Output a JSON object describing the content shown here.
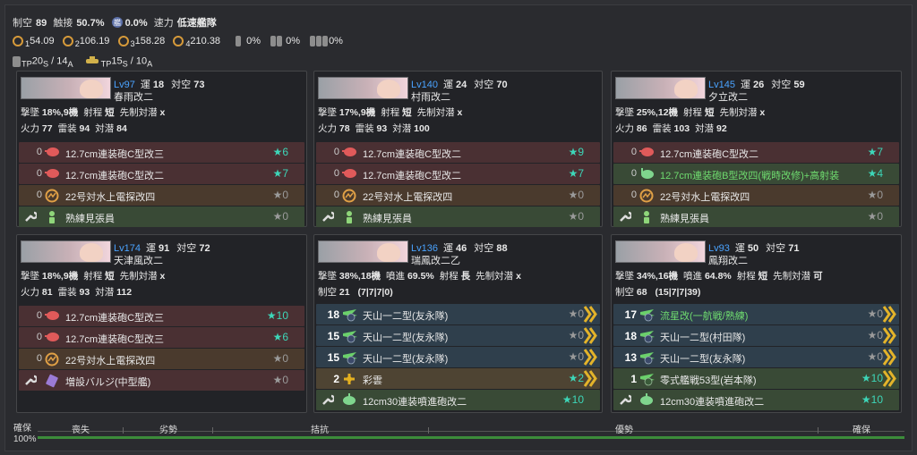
{
  "header": {
    "line1": {
      "seiku_label": "制空",
      "seiku": "89",
      "sessen_label": "触接",
      "sessen": "50.7%",
      "sessen2": "0.0%",
      "speed_label": "速力",
      "speed": "低速艦隊"
    },
    "line2": {
      "los1": "1",
      "los1v": "54.09",
      "los2": "2",
      "los2v": "106.19",
      "los3": "3",
      "los3v": "158.28",
      "los4": "4",
      "los4v": "210.38",
      "drum1": "0%",
      "drum2": "0%",
      "drum3": "0%"
    },
    "line3": {
      "tp_label": "TP",
      "tp_s": "20",
      "tp_s_sub": "S",
      "tp_a": "14",
      "tp_a_sub": "A",
      "tp2_label": "TP",
      "tp2_s": "15",
      "tp2_s_sub": "S",
      "tp2_a": "10",
      "tp2_a_sub": "A"
    }
  },
  "ships": [
    {
      "lv": "Lv97",
      "luck_label": "運",
      "luck": "18",
      "aa_label": "対空",
      "aa": "73",
      "name": "春雨改二",
      "line1": [
        {
          "l": "撃墜",
          "v": "18%,9機"
        },
        {
          "l": "射程",
          "v": "短"
        },
        {
          "l": "先制対潜",
          "v": "x"
        }
      ],
      "line2": [
        {
          "l": "火力",
          "v": "77"
        },
        {
          "l": "雷装",
          "v": "94"
        },
        {
          "l": "対潜",
          "v": "84"
        }
      ],
      "slots": [
        {
          "type": "red",
          "icon": "gun-icon",
          "count": "0",
          "name": "12.7cm連装砲C型改三",
          "star": "★6",
          "sc": "teal"
        },
        {
          "type": "red",
          "icon": "gun-icon",
          "count": "0",
          "name": "12.7cm連装砲C型改二",
          "star": "★7",
          "sc": "teal"
        },
        {
          "type": "brn",
          "icon": "radar-icon",
          "count": "0",
          "name": "22号対水上電探改四",
          "star": "★0",
          "sc": "grey"
        },
        {
          "type": "grn",
          "icon": "lookout-icon",
          "count": "",
          "name": "熟練見張員",
          "star": "★0",
          "sc": "grey",
          "ex": true
        }
      ]
    },
    {
      "lv": "Lv140",
      "luck_label": "運",
      "luck": "24",
      "aa_label": "対空",
      "aa": "70",
      "name": "村雨改二",
      "line1": [
        {
          "l": "撃墜",
          "v": "17%,9機"
        },
        {
          "l": "射程",
          "v": "短"
        },
        {
          "l": "先制対潜",
          "v": "x"
        }
      ],
      "line2": [
        {
          "l": "火力",
          "v": "78"
        },
        {
          "l": "雷装",
          "v": "93"
        },
        {
          "l": "対潜",
          "v": "100"
        }
      ],
      "slots": [
        {
          "type": "red",
          "icon": "gun-icon",
          "count": "0",
          "name": "12.7cm連装砲C型改二",
          "star": "★9",
          "sc": "teal"
        },
        {
          "type": "red",
          "icon": "gun-icon",
          "count": "0",
          "name": "12.7cm連装砲C型改二",
          "star": "★7",
          "sc": "teal"
        },
        {
          "type": "brn",
          "icon": "radar-icon",
          "count": "0",
          "name": "22号対水上電探改四",
          "star": "★0",
          "sc": "grey"
        },
        {
          "type": "grn",
          "icon": "lookout-icon",
          "count": "",
          "name": "熟練見張員",
          "star": "★0",
          "sc": "grey",
          "ex": true
        }
      ]
    },
    {
      "lv": "Lv145",
      "luck_label": "運",
      "luck": "26",
      "aa_label": "対空",
      "aa": "59",
      "name": "夕立改二",
      "line1": [
        {
          "l": "撃墜",
          "v": "25%,12機"
        },
        {
          "l": "射程",
          "v": "短"
        },
        {
          "l": "先制対潜",
          "v": "x"
        }
      ],
      "line2": [
        {
          "l": "火力",
          "v": "86"
        },
        {
          "l": "雷装",
          "v": "103"
        },
        {
          "l": "対潜",
          "v": "92"
        }
      ],
      "slots": [
        {
          "type": "red",
          "icon": "gun-icon",
          "count": "0",
          "name": "12.7cm連装砲C型改二",
          "star": "★7",
          "sc": "teal"
        },
        {
          "type": "grn",
          "icon": "aa-gun-icon",
          "count": "0",
          "name": "12.7cm連装砲B型改四(戦時改修)+高射装",
          "star": "★4",
          "sc": "teal",
          "green": true
        },
        {
          "type": "brn",
          "icon": "radar-icon",
          "count": "0",
          "name": "22号対水上電探改四",
          "star": "★0",
          "sc": "grey"
        },
        {
          "type": "grn",
          "icon": "lookout-icon",
          "count": "",
          "name": "熟練見張員",
          "star": "★0",
          "sc": "grey",
          "ex": true
        }
      ]
    },
    {
      "lv": "Lv174",
      "luck_label": "運",
      "luck": "91",
      "aa_label": "対空",
      "aa": "72",
      "name": "天津風改二",
      "line1": [
        {
          "l": "撃墜",
          "v": "18%,9機"
        },
        {
          "l": "射程",
          "v": "短"
        },
        {
          "l": "先制対潜",
          "v": "x"
        }
      ],
      "line2": [
        {
          "l": "火力",
          "v": "81"
        },
        {
          "l": "雷装",
          "v": "93"
        },
        {
          "l": "対潜",
          "v": "112"
        }
      ],
      "slots": [
        {
          "type": "red",
          "icon": "gun-icon",
          "count": "0",
          "name": "12.7cm連装砲C型改三",
          "star": "★10",
          "sc": "teal"
        },
        {
          "type": "red",
          "icon": "gun-icon",
          "count": "0",
          "name": "12.7cm連装砲C型改三",
          "star": "★6",
          "sc": "teal"
        },
        {
          "type": "brn",
          "icon": "radar-icon",
          "count": "0",
          "name": "22号対水上電探改四",
          "star": "★0",
          "sc": "grey"
        },
        {
          "type": "red",
          "icon": "bulge-icon",
          "count": "",
          "name": "増設バルジ(中型艦)",
          "star": "★0",
          "sc": "grey",
          "ex": true
        }
      ]
    },
    {
      "lv": "Lv136",
      "luck_label": "運",
      "luck": "46",
      "aa_label": "対空",
      "aa": "88",
      "name": "瑞鳳改二乙",
      "line1": [
        {
          "l": "撃墜",
          "v": "38%,18機"
        },
        {
          "l": "噴進",
          "v": "69.5%"
        },
        {
          "l": "射程",
          "v": "長"
        },
        {
          "l": "先制対潜",
          "v": "x"
        }
      ],
      "line2": [
        {
          "l": "制空",
          "v": "21"
        },
        {
          "l": "",
          "v": "(7|7|7|0)"
        }
      ],
      "slots": [
        {
          "type": "blu",
          "icon": "torpedo-bomber-icon",
          "count": "18",
          "name": "天山一二型(友永隊)",
          "star": "★0",
          "sc": "grey",
          "chev": true
        },
        {
          "type": "blu",
          "icon": "torpedo-bomber-icon",
          "count": "15",
          "name": "天山一二型(友永隊)",
          "star": "★0",
          "sc": "grey",
          "chev": true
        },
        {
          "type": "blu",
          "icon": "torpedo-bomber-icon",
          "count": "15",
          "name": "天山一二型(友永隊)",
          "star": "★0",
          "sc": "grey",
          "chev": true
        },
        {
          "type": "yel",
          "icon": "recon-plane-icon",
          "count": "2",
          "name": "彩雲",
          "star": "★2",
          "sc": "teal",
          "chev": true
        },
        {
          "type": "grn",
          "icon": "rocket-aa-icon",
          "count": "",
          "name": "12cm30連装噴進砲改二",
          "star": "★10",
          "sc": "teal",
          "ex": true
        }
      ]
    },
    {
      "lv": "Lv93",
      "luck_label": "運",
      "luck": "50",
      "aa_label": "対空",
      "aa": "71",
      "name": "鳳翔改二",
      "line1": [
        {
          "l": "撃墜",
          "v": "34%,16機"
        },
        {
          "l": "噴進",
          "v": "64.8%"
        },
        {
          "l": "射程",
          "v": "短"
        },
        {
          "l": "先制対潜",
          "v": "可"
        }
      ],
      "line2": [
        {
          "l": "制空",
          "v": "68"
        },
        {
          "l": "",
          "v": "(15|7|7|39)"
        }
      ],
      "slots": [
        {
          "type": "blu",
          "icon": "torpedo-bomber-icon",
          "count": "17",
          "name": "流星改(一航戦/熟練)",
          "star": "★0",
          "sc": "grey",
          "chev": true,
          "green": true
        },
        {
          "type": "blu",
          "icon": "torpedo-bomber-icon",
          "count": "18",
          "name": "天山一二型(村田隊)",
          "star": "★0",
          "sc": "grey",
          "chev": true
        },
        {
          "type": "blu",
          "icon": "torpedo-bomber-icon",
          "count": "13",
          "name": "天山一二型(友永隊)",
          "star": "★0",
          "sc": "grey",
          "chev": true
        },
        {
          "type": "grn",
          "icon": "fighter-icon",
          "count": "1",
          "name": "零式艦戦53型(岩本隊)",
          "star": "★10",
          "sc": "teal",
          "chev": true
        },
        {
          "type": "grn",
          "icon": "rocket-aa-icon",
          "count": "",
          "name": "12cm30連装噴進砲改二",
          "star": "★10",
          "sc": "teal",
          "ex": true
        }
      ]
    }
  ],
  "airbar": {
    "left_top": "確保",
    "left_bottom": "100%",
    "labels": [
      "喪失",
      "劣勢",
      "拮抗",
      "優勢",
      "確保"
    ],
    "percent": 100
  }
}
